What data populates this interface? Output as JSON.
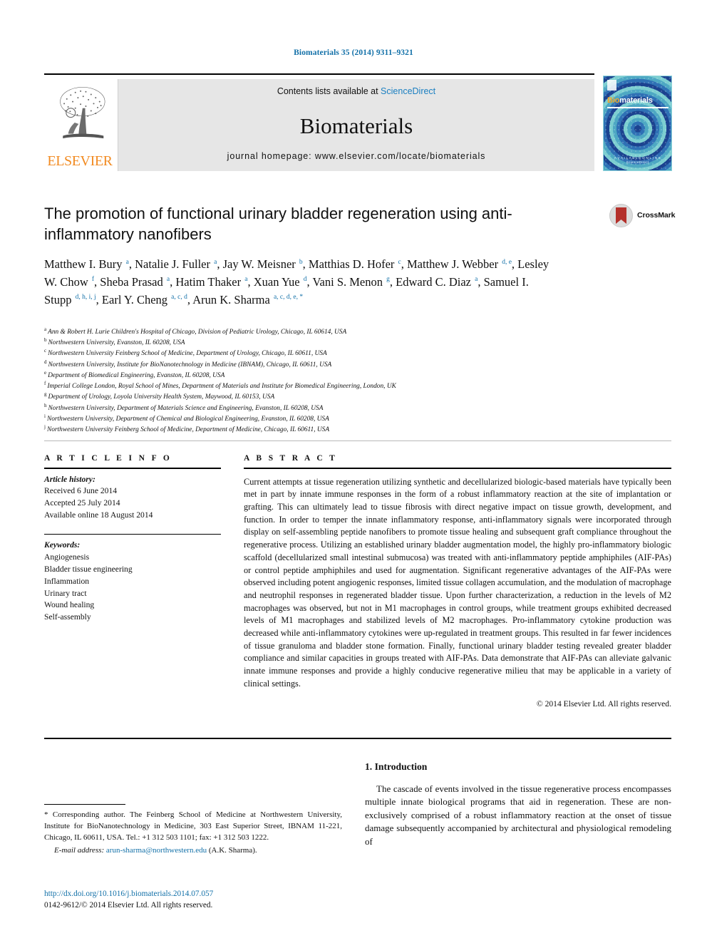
{
  "running_head": "Biomaterials 35 (2014) 9311–9321",
  "masthead": {
    "contents_prefix": "Contents lists available at ",
    "contents_link": "ScienceDirect",
    "journal_name": "Biomaterials",
    "homepage": "journal homepage: www.elsevier.com/locate/biomaterials",
    "publisher_wordmark": "ELSEVIER",
    "cover": {
      "title_first": "Bio",
      "title_rest": "materials",
      "footer_line1": "A V A I L A B L E   O N L I N E",
      "footer_line2": "ScienceDirect"
    }
  },
  "crossmark": {
    "label": "CrossMark"
  },
  "article": {
    "title": "The promotion of functional urinary bladder regeneration using anti-inflammatory nanofibers",
    "authors_html": "Matthew I. Bury <sup>a</sup>, Natalie J. Fuller <sup>a</sup>, Jay W. Meisner <sup>b</sup>, Matthias D. Hofer <sup>c</sup>, Matthew J. Webber <sup>d, e</sup>, Lesley W. Chow <sup>f</sup>, Sheba Prasad <sup>a</sup>, Hatim Thaker <sup>a</sup>, Xuan Yue <sup>d</sup>, Vani S. Menon <sup>g</sup>, Edward C. Diaz <sup>a</sup>, Samuel I. Stupp <sup>d, h, i, j</sup>, Earl Y. Cheng <sup>a, c, d</sup>, Arun K. Sharma <sup>a, c, d, e, *</sup>",
    "affiliations": [
      {
        "marker": "a",
        "text": "Ann & Robert H. Lurie Children's Hospital of Chicago, Division of Pediatric Urology, Chicago, IL 60614, USA"
      },
      {
        "marker": "b",
        "text": "Northwestern University, Evanston, IL 60208, USA"
      },
      {
        "marker": "c",
        "text": "Northwestern University Feinberg School of Medicine, Department of Urology, Chicago, IL 60611, USA"
      },
      {
        "marker": "d",
        "text": "Northwestern University, Institute for BioNanotechnology in Medicine (IBNAM), Chicago, IL 60611, USA"
      },
      {
        "marker": "e",
        "text": "Department of Biomedical Engineering, Evanston, IL 60208, USA"
      },
      {
        "marker": "f",
        "text": "Imperial College London, Royal School of Mines, Department of Materials and Institute for Biomedical Engineering, London, UK"
      },
      {
        "marker": "g",
        "text": "Department of Urology, Loyola University Health System, Maywood, IL 60153, USA"
      },
      {
        "marker": "h",
        "text": "Northwestern University, Department of Materials Science and Engineering, Evanston, IL 60208, USA"
      },
      {
        "marker": "i",
        "text": "Northwestern University, Department of Chemical and Biological Engineering, Evanston, IL 60208, USA"
      },
      {
        "marker": "j",
        "text": "Northwestern University Feinberg School of Medicine, Department of Medicine, Chicago, IL 60611, USA"
      }
    ]
  },
  "article_info": {
    "heading": "A R T I C L E  I N F O",
    "history_label": "Article history:",
    "history": [
      "Received 6 June 2014",
      "Accepted 25 July 2014",
      "Available online 18 August 2014"
    ],
    "keywords_label": "Keywords:",
    "keywords": [
      "Angiogenesis",
      "Bladder tissue engineering",
      "Inflammation",
      "Urinary tract",
      "Wound healing",
      "Self-assembly"
    ]
  },
  "abstract": {
    "heading": "A B S T R A C T",
    "text": "Current attempts at tissue regeneration utilizing synthetic and decellularized biologic-based materials have typically been met in part by innate immune responses in the form of a robust inflammatory reaction at the site of implantation or grafting. This can ultimately lead to tissue fibrosis with direct negative impact on tissue growth, development, and function. In order to temper the innate inflammatory response, anti-inflammatory signals were incorporated through display on self-assembling peptide nanofibers to promote tissue healing and subsequent graft compliance throughout the regenerative process. Utilizing an established urinary bladder augmentation model, the highly pro-inflammatory biologic scaffold (decellularized small intestinal submucosa) was treated with anti-inflammatory peptide amphiphiles (AIF-PAs) or control peptide amphiphiles and used for augmentation. Significant regenerative advantages of the AIF-PAs were observed including potent angiogenic responses, limited tissue collagen accumulation, and the modulation of macrophage and neutrophil responses in regenerated bladder tissue. Upon further characterization, a reduction in the levels of M2 macrophages was observed, but not in M1 macrophages in control groups, while treatment groups exhibited decreased levels of M1 macrophages and stabilized levels of M2 macrophages. Pro-inflammatory cytokine production was decreased while anti-inflammatory cytokines were up-regulated in treatment groups. This resulted in far fewer incidences of tissue granuloma and bladder stone formation. Finally, functional urinary bladder testing revealed greater bladder compliance and similar capacities in groups treated with AIF-PAs. Data demonstrate that AIF-PAs can alleviate galvanic innate immune responses and provide a highly conducive regenerative milieu that may be applicable in a variety of clinical settings.",
    "copyright": "© 2014 Elsevier Ltd. All rights reserved."
  },
  "body": {
    "section_heading": "1. Introduction",
    "paragraph": "The cascade of events involved in the tissue regenerative process encompasses multiple innate biological programs that aid in regeneration. These are non-exclusively comprised of a robust inflammatory reaction at the onset of tissue damage subsequently accompanied by architectural and physiological remodeling of"
  },
  "footnote": {
    "corresponding": "* Corresponding author. The Feinberg School of Medicine at Northwestern University, Institute for BioNanotechnology in Medicine, 303 East Superior Street, IBNAM 11-221, Chicago, IL 60611, USA. Tel.: +1 312 503 1101; fax: +1 312 503 1222.",
    "email_label": "E-mail address:",
    "email": "arun-sharma@northwestern.edu",
    "email_suffix": "(A.K. Sharma)."
  },
  "bottom": {
    "doi": "http://dx.doi.org/10.1016/j.biomaterials.2014.07.057",
    "issn": "0142-9612/© 2014 Elsevier Ltd. All rights reserved."
  },
  "colors": {
    "link_blue": "#1270a8",
    "elsevier_orange": "#f28b22",
    "crossmark_red": "#b4302b"
  }
}
